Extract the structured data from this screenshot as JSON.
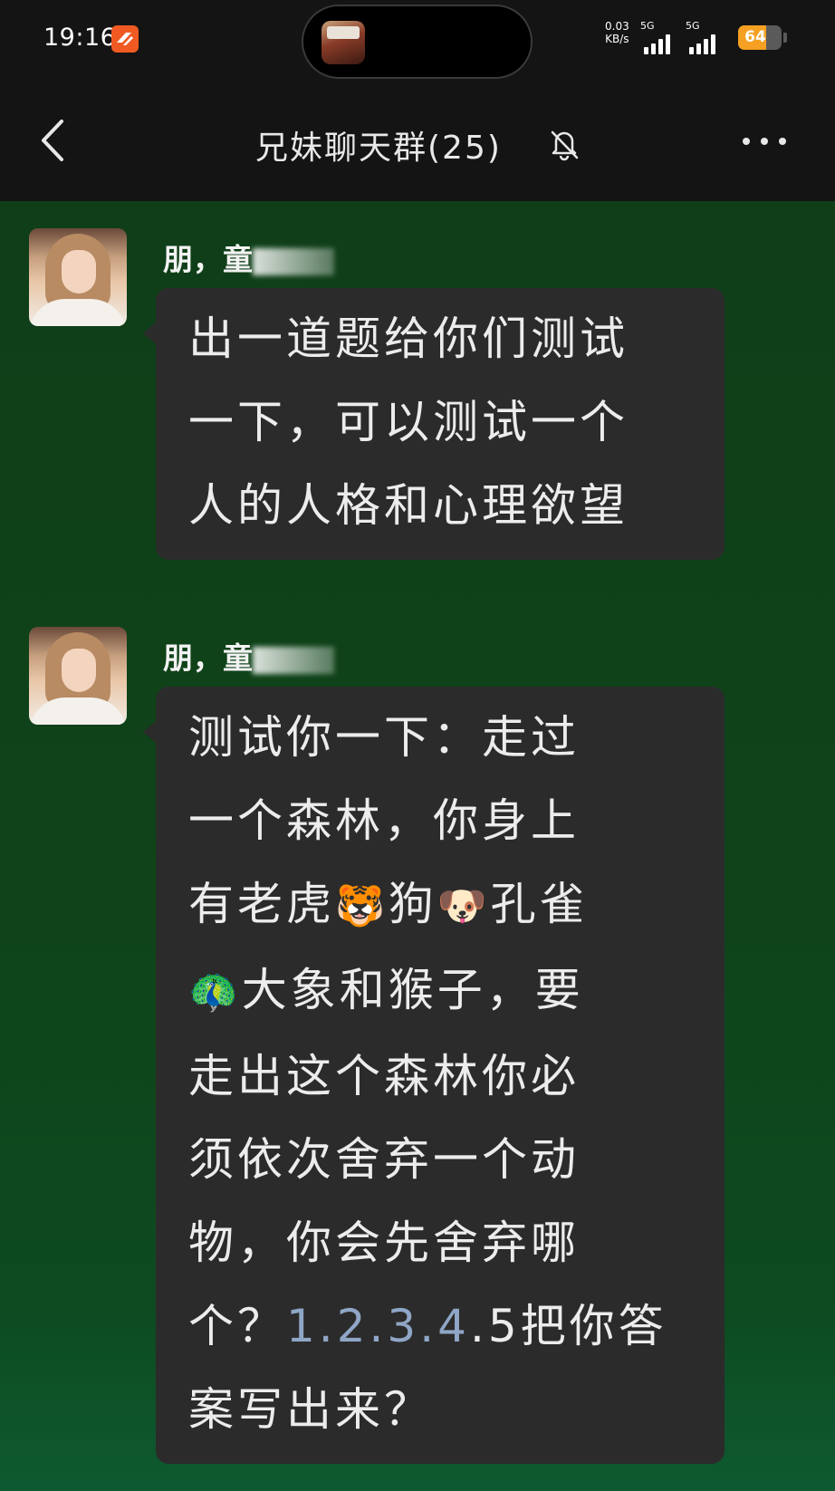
{
  "status_bar": {
    "time": "19:16",
    "net_speed_value": "0.03",
    "net_speed_unit": "KB/s",
    "signal1_label": "5G",
    "signal2_label": "5G",
    "battery_level": 64,
    "battery_text": "64",
    "battery_color": "#f5a022"
  },
  "nav": {
    "title": "兄妹聊天群(25)",
    "back_icon": "chevron-left-icon",
    "mute_icon": "bell-off-icon",
    "more_icon": "more-dots-icon"
  },
  "messages": [
    {
      "sender": "朋，童",
      "lines": [
        "出一道题给你们测试",
        "一下，可以测试一个",
        "人的人格和心理欲望"
      ]
    },
    {
      "sender": "朋，童",
      "lines_text": [
        "测试你一下：走过",
        "一个森林，你身上",
        "有老虎",
        "🐯",
        "狗",
        "🐶",
        "孔雀",
        "🦚",
        "大象和猴子，要",
        "走出这个森林你必",
        "须依次舍弃一个动",
        "物，你会先舍弃哪",
        "个？",
        "1.2.3.4",
        ".5把你答",
        "案写出来？"
      ]
    }
  ],
  "colors": {
    "background": "#0f3f19",
    "header": "#141414",
    "bubble": "#2b2b2b",
    "link": "#8fa6c6"
  }
}
